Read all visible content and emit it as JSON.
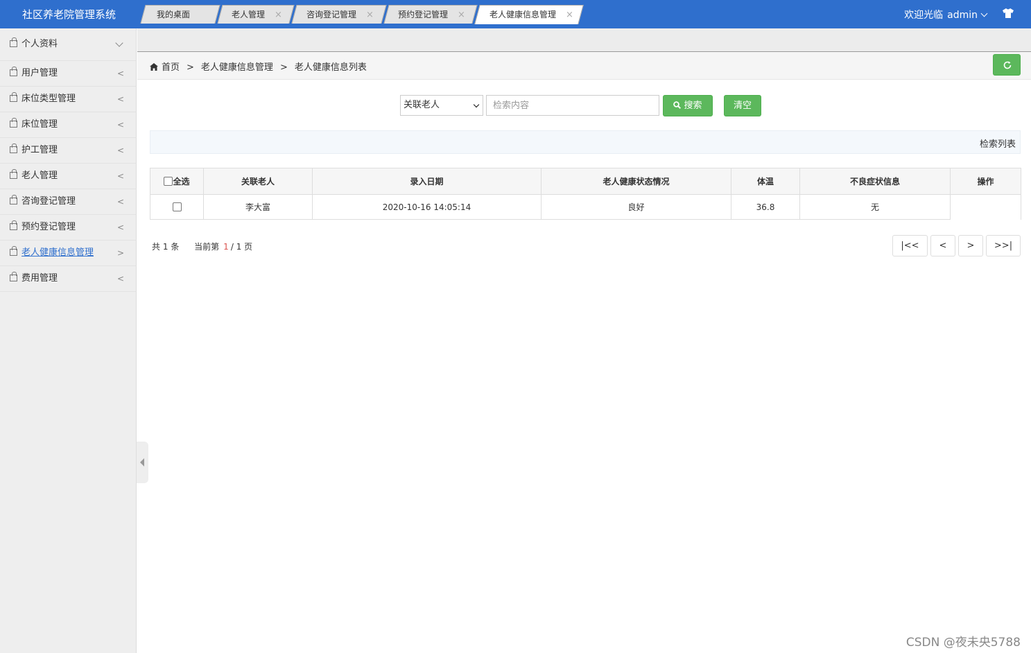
{
  "header": {
    "app_title": "社区养老院管理系统",
    "welcome": "欢迎光临",
    "user": "admin"
  },
  "sidebar": {
    "items": [
      {
        "label": "个人资料",
        "state": "expanded"
      },
      {
        "label": "用户管理",
        "state": "collapsed"
      },
      {
        "label": "床位类型管理",
        "state": "collapsed"
      },
      {
        "label": "床位管理",
        "state": "collapsed"
      },
      {
        "label": "护工管理",
        "state": "collapsed"
      },
      {
        "label": "老人管理",
        "state": "collapsed"
      },
      {
        "label": "咨询登记管理",
        "state": "collapsed"
      },
      {
        "label": "预约登记管理",
        "state": "collapsed"
      },
      {
        "label": "老人健康信息管理",
        "state": "active"
      },
      {
        "label": "费用管理",
        "state": "collapsed"
      }
    ],
    "collapsed_arrow": "<",
    "active_arrow": ">"
  },
  "tabs": [
    {
      "label": "我的桌面",
      "closable": false
    },
    {
      "label": "老人管理",
      "closable": true
    },
    {
      "label": "咨询登记管理",
      "closable": true
    },
    {
      "label": "预约登记管理",
      "closable": true
    },
    {
      "label": "老人健康信息管理",
      "closable": true,
      "active": true
    }
  ],
  "tab_close_glyph": "×",
  "breadcrumb": {
    "home": "首页",
    "sep": ">",
    "level1": "老人健康信息管理",
    "level2": "老人健康信息列表"
  },
  "search": {
    "field_selected": "关联老人",
    "placeholder": "检索内容",
    "search_label": "搜索",
    "clear_label": "清空"
  },
  "list_title": "检索列表",
  "table": {
    "select_all_label": "全选",
    "columns": [
      "关联老人",
      "录入日期",
      "老人健康状态情况",
      "体温",
      "不良症状信息",
      "操作"
    ],
    "rows": [
      {
        "elder": "李大富",
        "date": "2020-10-16 14:05:14",
        "status": "良好",
        "temperature": "36.8",
        "symptoms": "无",
        "actions": ""
      }
    ]
  },
  "pager": {
    "total_prefix": "共",
    "total": "1",
    "total_suffix": "条",
    "current_prefix": "当前第",
    "current": "1",
    "slash": "/",
    "pages": "1",
    "pages_suffix": "页",
    "first": "|<<",
    "prev": "<",
    "next": ">",
    "last": ">>|"
  },
  "watermark": "CSDN @夜未央5788",
  "colors": {
    "header_bg": "#2f6fcd",
    "button_green": "#5cb85c",
    "current_page": "#d9534f"
  }
}
